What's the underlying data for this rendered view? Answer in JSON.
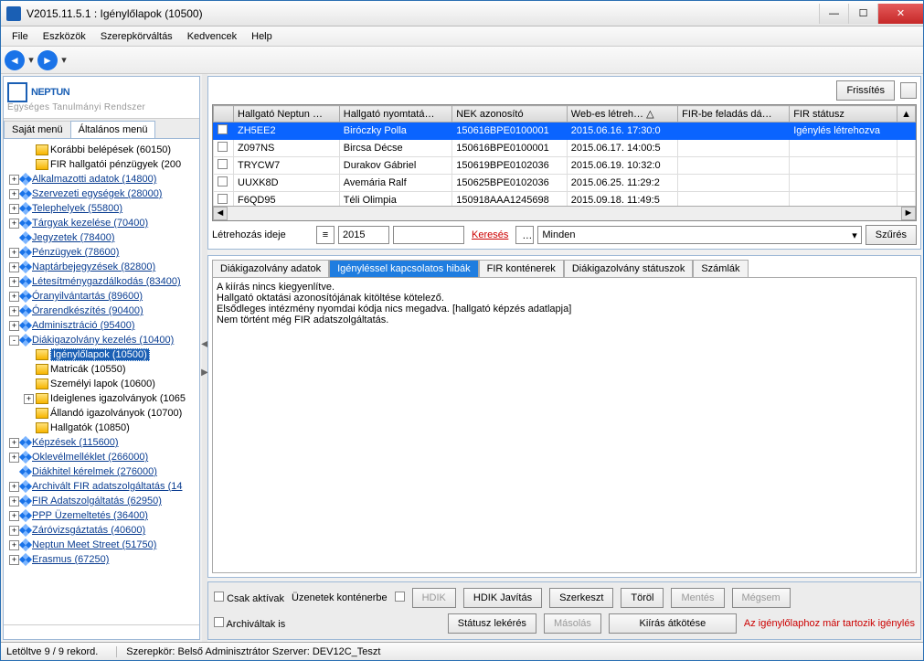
{
  "title": "V2015.11.5.1 : Igénylőlapok (10500)",
  "menu": [
    "File",
    "Eszközök",
    "Szerepkörváltás",
    "Kedvencek",
    "Help"
  ],
  "logo": {
    "main": "NEPTUN",
    "sub": "Egységes Tanulmányi Rendszer"
  },
  "leftTabs": {
    "a": "Saját menü",
    "b": "Általános menü"
  },
  "tree": [
    {
      "lvl": 1,
      "exp": "",
      "ic": "y",
      "txt": "Korábbi belépések (60150)",
      "sel": false,
      "link": false
    },
    {
      "lvl": 1,
      "exp": "",
      "ic": "y",
      "txt": "FIR hallgatói pénzügyek (200",
      "sel": false,
      "link": false
    },
    {
      "lvl": 0,
      "exp": "+",
      "ic": "d",
      "txt": "Alkalmazotti adatok (14800)",
      "sel": false,
      "link": true
    },
    {
      "lvl": 0,
      "exp": "+",
      "ic": "d",
      "txt": "Szervezeti egységek (28000)",
      "sel": false,
      "link": true
    },
    {
      "lvl": 0,
      "exp": "+",
      "ic": "d",
      "txt": "Telephelyek (55800)",
      "sel": false,
      "link": true
    },
    {
      "lvl": 0,
      "exp": "+",
      "ic": "d",
      "txt": "Tárgyak kezelése (70400)",
      "sel": false,
      "link": true
    },
    {
      "lvl": 0,
      "exp": "",
      "ic": "d",
      "txt": "Jegyzetek (78400)",
      "sel": false,
      "link": true
    },
    {
      "lvl": 0,
      "exp": "+",
      "ic": "d",
      "txt": "Pénzügyek (78600)",
      "sel": false,
      "link": true
    },
    {
      "lvl": 0,
      "exp": "+",
      "ic": "d",
      "txt": "Naptárbejegyzések (82800)",
      "sel": false,
      "link": true
    },
    {
      "lvl": 0,
      "exp": "+",
      "ic": "d",
      "txt": "Létesítménygazdálkodás (83400)",
      "sel": false,
      "link": true
    },
    {
      "lvl": 0,
      "exp": "+",
      "ic": "d",
      "txt": "Óranyilvántartás (89600)",
      "sel": false,
      "link": true
    },
    {
      "lvl": 0,
      "exp": "+",
      "ic": "d",
      "txt": "Órarendkészítés (90400)",
      "sel": false,
      "link": true
    },
    {
      "lvl": 0,
      "exp": "+",
      "ic": "d",
      "txt": "Adminisztráció (95400)",
      "sel": false,
      "link": true
    },
    {
      "lvl": 0,
      "exp": "-",
      "ic": "d",
      "txt": "Diákigazolvány kezelés (10400)",
      "sel": false,
      "link": true
    },
    {
      "lvl": 1,
      "exp": "",
      "ic": "y",
      "txt": "Igénylőlapok (10500)",
      "sel": true,
      "link": false
    },
    {
      "lvl": 1,
      "exp": "",
      "ic": "y",
      "txt": "Matricák (10550)",
      "sel": false,
      "link": false
    },
    {
      "lvl": 1,
      "exp": "",
      "ic": "y",
      "txt": "Személyi lapok (10600)",
      "sel": false,
      "link": false
    },
    {
      "lvl": 1,
      "exp": "+",
      "ic": "y",
      "txt": "Ideiglenes igazolványok (1065",
      "sel": false,
      "link": false
    },
    {
      "lvl": 1,
      "exp": "",
      "ic": "y",
      "txt": "Állandó igazolványok (10700)",
      "sel": false,
      "link": false
    },
    {
      "lvl": 1,
      "exp": "",
      "ic": "y",
      "txt": "Hallgatók (10850)",
      "sel": false,
      "link": false
    },
    {
      "lvl": 0,
      "exp": "+",
      "ic": "d",
      "txt": "Képzések (115600)",
      "sel": false,
      "link": true
    },
    {
      "lvl": 0,
      "exp": "+",
      "ic": "d",
      "txt": "Oklevélmelléklet (266000)",
      "sel": false,
      "link": true
    },
    {
      "lvl": 0,
      "exp": "",
      "ic": "d",
      "txt": "Diákhitel kérelmek (276000)",
      "sel": false,
      "link": true
    },
    {
      "lvl": 0,
      "exp": "+",
      "ic": "d",
      "txt": "Archivált FIR adatszolgáltatás (14",
      "sel": false,
      "link": true
    },
    {
      "lvl": 0,
      "exp": "+",
      "ic": "d",
      "txt": "FIR Adatszolgáltatás (62950)",
      "sel": false,
      "link": true
    },
    {
      "lvl": 0,
      "exp": "+",
      "ic": "d",
      "txt": "PPP Üzemeltetés (36400)",
      "sel": false,
      "link": true
    },
    {
      "lvl": 0,
      "exp": "+",
      "ic": "d",
      "txt": "Záróvizsgáztatás (40600)",
      "sel": false,
      "link": true
    },
    {
      "lvl": 0,
      "exp": "+",
      "ic": "d",
      "txt": "Neptun Meet Street (51750)",
      "sel": false,
      "link": true
    },
    {
      "lvl": 0,
      "exp": "+",
      "ic": "d",
      "txt": "Erasmus (67250)",
      "sel": false,
      "link": true
    }
  ],
  "refreshBtn": "Frissítés",
  "gridCols": [
    "",
    "Hallgató Neptun …",
    "Hallgató nyomtatá…",
    "NEK azonosító",
    "Web-es létreh…  △",
    "FIR-be feladás dá…",
    "FIR státusz"
  ],
  "gridRows": [
    {
      "c": [
        "",
        "ZH5EE2",
        "Biróczky Polla",
        "150616BPE0100001",
        "2015.06.16. 17:30:0",
        "",
        "Igénylés létrehozva"
      ],
      "sel": true
    },
    {
      "c": [
        "",
        "Z097NS",
        "Bircsa Décse",
        "150616BPE0100001",
        "2015.06.17. 14:00:5",
        "",
        ""
      ],
      "sel": false
    },
    {
      "c": [
        "",
        "TRYCW7",
        "Durakov Gábriel",
        "150619BPE0102036",
        "2015.06.19. 10:32:0",
        "",
        ""
      ],
      "sel": false
    },
    {
      "c": [
        "",
        "UUXK8D",
        "Avemária Ralf",
        "150625BPE0102036",
        "2015.06.25. 11:29:2",
        "",
        ""
      ],
      "sel": false
    },
    {
      "c": [
        "",
        "F6QD95",
        "Téli Olimpia",
        "150918AAA1245698",
        "2015.09.18. 11:49:5",
        "",
        ""
      ],
      "sel": false
    }
  ],
  "filter": {
    "label": "Létrehozás ideje",
    "year": "2015",
    "kereses": "Keresés",
    "dots": "…",
    "minden": "Minden",
    "szures": "Szűrés"
  },
  "midTabs": [
    "Diákigazolvány adatok",
    "Igényléssel kapcsolatos hibák",
    "FIR konténerek",
    "Diákigazolvány státuszok",
    "Számlák"
  ],
  "midContent": [
    "A kiírás nincs kiegyenlítve.",
    "Hallgató oktatási azonosítójának kitöltése kötelező.",
    "Elsődleges intézmény nyomdai kódja nics megadva. [hallgató képzés adatlapja]",
    "Nem történt még FIR adatszolgáltatás."
  ],
  "bottom": {
    "csak": "Csak aktívak",
    "arch": "Archiváltak is",
    "uzk": "Üzenetek konténerbe",
    "hdik": "HDIK",
    "hdikj": "HDIK Javítás",
    "szerk": "Szerkeszt",
    "torol": "Töröl",
    "mentes": "Mentés",
    "megse": "Mégsem",
    "statlek": "Státusz lekérés",
    "masolas": "Másolás",
    "kiiras": "Kiírás átkötése",
    "redmsg": "Az igénylőlaphoz már tartozik igénylés"
  },
  "status": {
    "a": "Letöltve 9 / 9 rekord.",
    "b": "Szerepkör: Belső Adminisztrátor   Szerver: DEV12C_Teszt"
  }
}
